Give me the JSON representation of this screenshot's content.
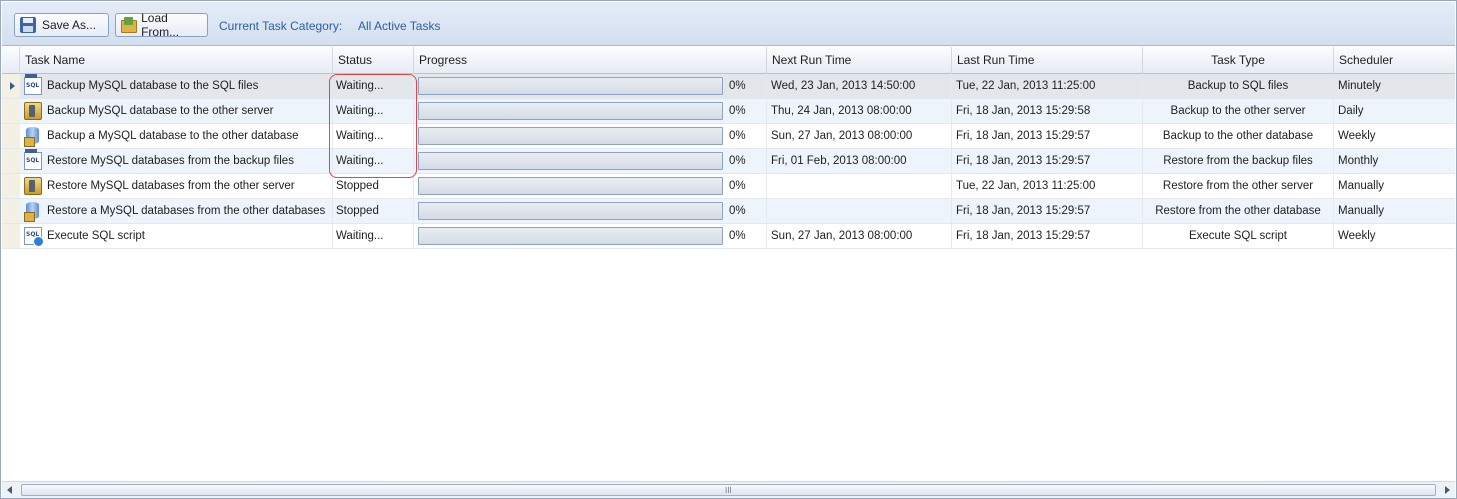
{
  "toolbar": {
    "save_label": "Save As...",
    "load_label": "Load From...",
    "category_label": "Current Task Category:",
    "category_value": "All Active Tasks"
  },
  "columns": {
    "task_name": "Task Name",
    "status": "Status",
    "progress": "Progress",
    "next_run": "Next Run Time",
    "last_run": "Last Run Time",
    "task_type": "Task Type",
    "scheduler": "Scheduler"
  },
  "rows": [
    {
      "icon": "sql-backup-icon",
      "name": "Backup MySQL database to the SQL files",
      "status": "Waiting...",
      "progress": 0,
      "progress_text": "0%",
      "next_run": "Wed, 23 Jan, 2013 14:50:00",
      "last_run": "Tue, 22 Jan, 2013 11:25:00",
      "type": "Backup to SQL files",
      "scheduler": "Minutely"
    },
    {
      "icon": "server-backup-icon",
      "name": "Backup MySQL database to the other server",
      "status": "Waiting...",
      "progress": 0,
      "progress_text": "0%",
      "next_run": "Thu, 24 Jan, 2013 08:00:00",
      "last_run": "Fri, 18 Jan, 2013 15:29:58",
      "type": "Backup to the other server",
      "scheduler": "Daily"
    },
    {
      "icon": "database-backup-icon",
      "name": "Backup a MySQL database to the other database",
      "status": "Waiting...",
      "progress": 0,
      "progress_text": "0%",
      "next_run": "Sun, 27 Jan, 2013 08:00:00",
      "last_run": "Fri, 18 Jan, 2013 15:29:57",
      "type": "Backup to the other database",
      "scheduler": "Weekly"
    },
    {
      "icon": "sql-restore-icon",
      "name": "Restore MySQL databases from the backup files",
      "status": "Waiting...",
      "progress": 0,
      "progress_text": "0%",
      "next_run": "Fri, 01 Feb, 2013 08:00:00",
      "last_run": "Fri, 18 Jan, 2013 15:29:57",
      "type": "Restore from the backup files",
      "scheduler": "Monthly"
    },
    {
      "icon": "server-restore-icon",
      "name": "Restore MySQL databases from the other server",
      "status": "Stopped",
      "progress": 0,
      "progress_text": "0%",
      "next_run": "",
      "last_run": "Tue, 22 Jan, 2013 11:25:00",
      "type": "Restore from the other server",
      "scheduler": "Manually"
    },
    {
      "icon": "database-restore-icon",
      "name": "Restore a MySQL databases from the other databases",
      "status": "Stopped",
      "progress": 0,
      "progress_text": "0%",
      "next_run": "",
      "last_run": "Fri, 18 Jan, 2013 15:29:57",
      "type": "Restore from the other database",
      "scheduler": "Manually"
    },
    {
      "icon": "sql-script-icon",
      "name": "Execute SQL script",
      "status": "Waiting...",
      "progress": 0,
      "progress_text": "0%",
      "next_run": "Sun, 27 Jan, 2013 08:00:00",
      "last_run": "Fri, 18 Jan, 2013 15:29:57",
      "type": "Execute SQL script",
      "scheduler": "Weekly"
    }
  ],
  "scrollbar": {
    "grip": "III"
  }
}
